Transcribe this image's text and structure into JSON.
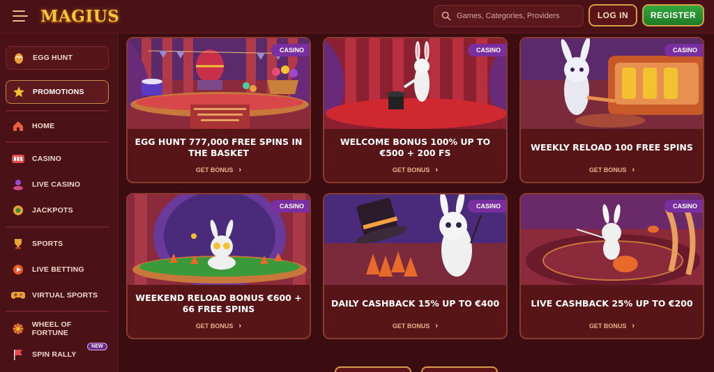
{
  "header": {
    "logo": "MAGIUS",
    "search_placeholder": "Games, Categories, Providers",
    "login_label": "LOG IN",
    "register_label": "REGISTER"
  },
  "sidebar": {
    "items": [
      {
        "label": "EGG HUNT",
        "icon": "egg-icon"
      },
      {
        "label": "PROMOTIONS",
        "icon": "star-icon"
      },
      {
        "label": "HOME",
        "icon": "house-icon"
      },
      {
        "label": "CASINO",
        "icon": "slot-icon"
      },
      {
        "label": "LIVE CASINO",
        "icon": "croupier-icon"
      },
      {
        "label": "JACKPOTS",
        "icon": "jackpot-icon"
      },
      {
        "label": "SPORTS",
        "icon": "trophy-icon"
      },
      {
        "label": "LIVE BETTING",
        "icon": "live-betting-icon"
      },
      {
        "label": "VIRTUAL SPORTS",
        "icon": "gamepad-icon"
      },
      {
        "label": "WHEEL OF FORTUNE",
        "icon": "wheel-icon"
      },
      {
        "label": "SPIN RALLY",
        "icon": "flag-icon",
        "badge": "NEW"
      }
    ]
  },
  "promotions": [
    {
      "badge": "CASINO",
      "title": "EGG HUNT 777,000 FREE SPINS IN THE BASKET",
      "cta": "GET BONUS"
    },
    {
      "badge": "CASINO",
      "title": "WELCOME BONUS 100% UP TO €500 + 200 FS",
      "cta": "GET BONUS"
    },
    {
      "badge": "CASINO",
      "title": "WEEKLY RELOAD 100 FREE SPINS",
      "cta": "GET BONUS"
    },
    {
      "badge": "CASINO",
      "title": "WEEKEND RELOAD BONUS €600 + 66 FREE SPINS",
      "cta": "GET BONUS"
    },
    {
      "badge": "CASINO",
      "title": "DAILY CASHBACK 15% UP TO €400",
      "cta": "GET BONUS"
    },
    {
      "badge": "CASINO",
      "title": "LIVE CASHBACK 25% UP TO €200",
      "cta": "GET BONUS"
    }
  ],
  "colors": {
    "background": "#3b0d10",
    "accent_gold": "#d6a04a",
    "register_green": "#2a9433",
    "badge_purple": "#7a2fa0"
  }
}
